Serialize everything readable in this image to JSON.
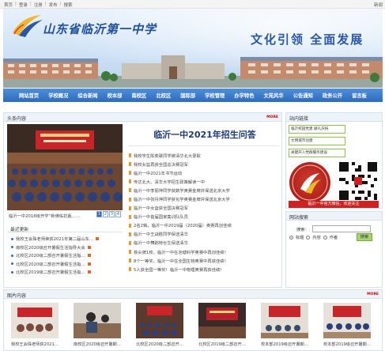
{
  "topbar": {
    "links": [
      "首页",
      "登录",
      "注册",
      "发布",
      "搜索"
    ],
    "right": "新闻"
  },
  "banner": {
    "school_name": "山东省临沂第一中学",
    "slogan": "文化引领 全面发展"
  },
  "nav": {
    "items": [
      "网站首页",
      "学校概况",
      "综合新闻",
      "校本部",
      "南校区",
      "北校区",
      "国际部",
      "学校管理",
      "办学特色",
      "文苑风华",
      "公告通知",
      "政务公开",
      "留言板"
    ]
  },
  "news": {
    "panel_title": "头条内容",
    "more": "MORE",
    "photo_caption": "临沂一中2018级开学“新佛佑抗氟……",
    "pages": [
      "1",
      "2",
      "3",
      "4"
    ],
    "headline": "临沂一中2021年招生问答",
    "articles": [
      "我校学生陈奕歌同学被清华北大录取",
      "我校女篮再获全国总决赛冠军",
      "临沂一中2021年书节运动",
      "传达北大、清华大学招生政策解读一中",
      "临沂一中李丽萍同学获数学奥赛金牌并保送北京大学",
      "临沂一中张丹萍同学获化学奥赛金牌并保送北京大学",
      "临沂一中女篮获全国决赛冠军",
      "临沂一中首届国家集训队队员",
      "2名2辑，临沂一中2019届（2020届）奥赛再创佳绩",
      "临沂一中王战胜同学保送清华",
      "临沂一中舞蹈特长生保送清华",
      "铁尖牌1枚，临沂一中在池塘科学奥赛中再创佳绩！",
      "8个一等奖，临沂一中在全国生物奥赛中再获佳绩！",
      "5人获全国一等奖！临沂一中物理奥赛再获佳绩！"
    ]
  },
  "recent": {
    "title": "最近更新",
    "items": [
      "我校王会珠老师荣获2021年第二届山东…",
      "南校区2020级召开暑假生活指导大会",
      "北校区2020级二部召开暑假生活指…",
      "北校区2020级二部召开暑假生活指…",
      "北校区2019级二部召开暑假生活指…"
    ]
  },
  "side": {
    "panel_title": "站内链接",
    "links": [
      "临沂校园党建 献礼庆祝",
      "文明城市创建",
      "关键开入党群服务建设"
    ],
    "qr_caption": "临沂一中官方微信，欢迎关注"
  },
  "search": {
    "panel_title": "网站搜索",
    "label": "搜索：",
    "placeholder": "",
    "options": [
      "标题",
      "内容",
      "作者"
    ],
    "button": "搜索"
  },
  "photos": {
    "panel_title": "图片内容",
    "more": "MORE",
    "captions": [
      "我校王会珠老师获2021…",
      "南校区2020级召开暑期…",
      "北校区2020级二部召开…",
      "北校区2019级二部召开…",
      "校本部2019级召开暑期…",
      "校本部2019级召开暑期…"
    ]
  }
}
